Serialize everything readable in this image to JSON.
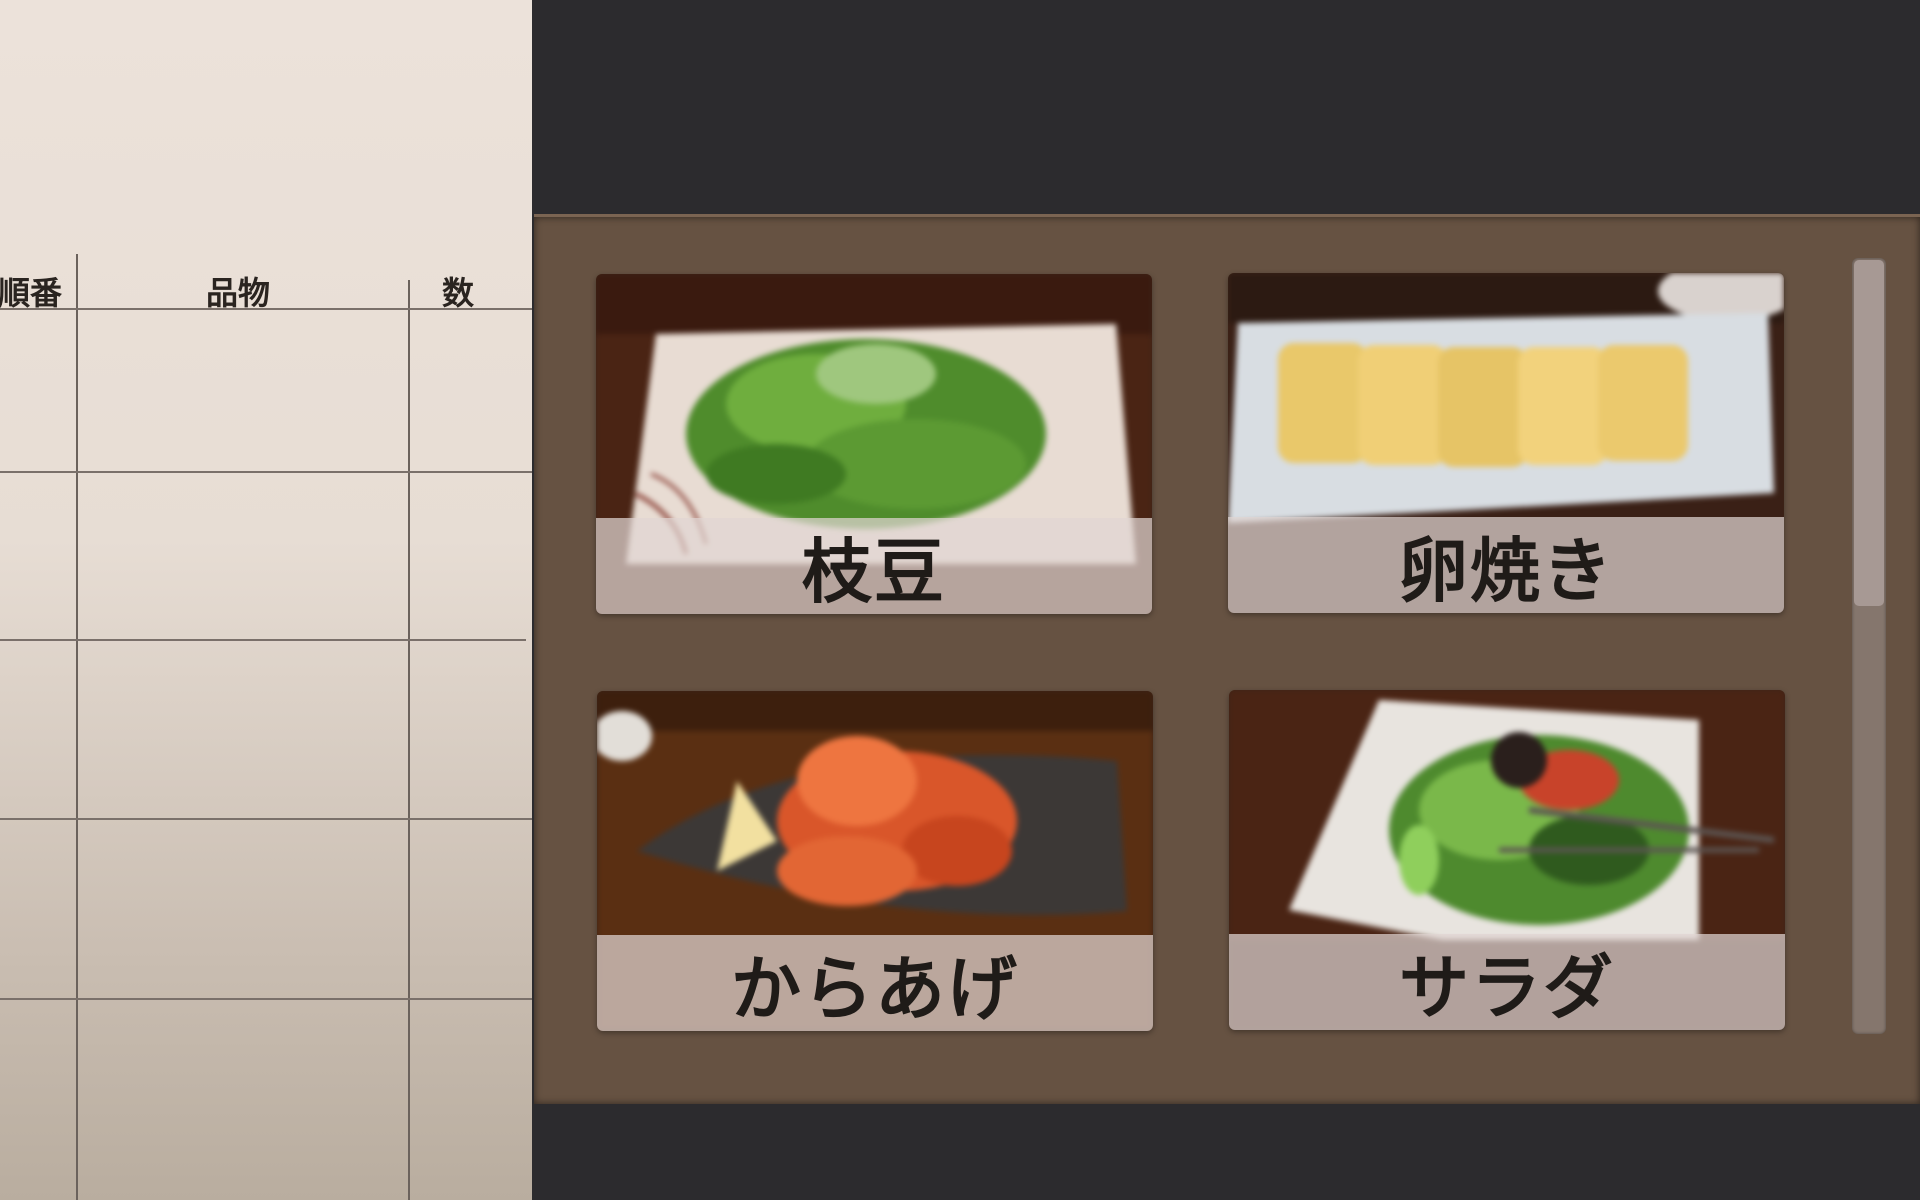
{
  "order_sheet": {
    "headers": {
      "order": "順番",
      "item": "品物",
      "count": "数"
    },
    "rows": 5
  },
  "menu": {
    "items": [
      {
        "label": "枝豆",
        "photo": "edamame-plate"
      },
      {
        "label": "卵焼き",
        "photo": "tamagoyaki-plate"
      },
      {
        "label": "からあげ",
        "photo": "karaage-plate"
      },
      {
        "label": "サラダ",
        "photo": "salad-plate"
      }
    ]
  },
  "colors": {
    "panel": "#665242",
    "background": "#2c2b2e",
    "sheet": "#ece2da",
    "label_band": "#e1d6d2"
  }
}
